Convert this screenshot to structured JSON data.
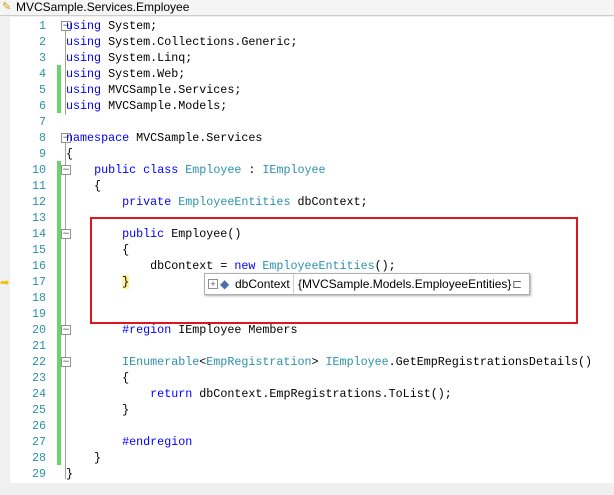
{
  "window": {
    "title": "MVCSample.Services.Employee"
  },
  "code": [
    {
      "n": "1",
      "t": [
        [
          "kw",
          "using"
        ],
        [
          "pl",
          " System;"
        ]
      ]
    },
    {
      "n": "2",
      "t": [
        [
          "kw",
          "using"
        ],
        [
          "pl",
          " System.Collections.Generic;"
        ]
      ]
    },
    {
      "n": "3",
      "t": [
        [
          "kw",
          "using"
        ],
        [
          "pl",
          " System.Linq;"
        ]
      ]
    },
    {
      "n": "4",
      "t": [
        [
          "kw",
          "using"
        ],
        [
          "pl",
          " System.Web;"
        ]
      ]
    },
    {
      "n": "5",
      "t": [
        [
          "kw",
          "using"
        ],
        [
          "pl",
          " MVCSample.Services;"
        ]
      ]
    },
    {
      "n": "6",
      "t": [
        [
          "kw",
          "using"
        ],
        [
          "pl",
          " MVCSample.Models;"
        ]
      ]
    },
    {
      "n": "7",
      "t": []
    },
    {
      "n": "8",
      "t": [
        [
          "kw",
          "namespace"
        ],
        [
          "pl",
          " MVCSample.Services"
        ]
      ]
    },
    {
      "n": "9",
      "t": [
        [
          "pl",
          "{"
        ]
      ]
    },
    {
      "n": "10",
      "t": [
        [
          "pl",
          "    "
        ],
        [
          "kw",
          "public"
        ],
        [
          "pl",
          " "
        ],
        [
          "kw",
          "class"
        ],
        [
          "pl",
          " "
        ],
        [
          "ty",
          "Employee"
        ],
        [
          "pl",
          " : "
        ],
        [
          "ty",
          "IEmployee"
        ]
      ]
    },
    {
      "n": "11",
      "t": [
        [
          "pl",
          "    {"
        ]
      ]
    },
    {
      "n": "12",
      "t": [
        [
          "pl",
          "        "
        ],
        [
          "kw",
          "private"
        ],
        [
          "pl",
          " "
        ],
        [
          "ty",
          "EmployeeEntities"
        ],
        [
          "pl",
          " dbContext;"
        ]
      ]
    },
    {
      "n": "13",
      "t": []
    },
    {
      "n": "14",
      "t": [
        [
          "pl",
          "        "
        ],
        [
          "kw",
          "public"
        ],
        [
          "pl",
          " Employee()"
        ]
      ]
    },
    {
      "n": "15",
      "t": [
        [
          "pl",
          "        {"
        ]
      ]
    },
    {
      "n": "16",
      "t": [
        [
          "pl",
          "            dbContext = "
        ],
        [
          "kw",
          "new"
        ],
        [
          "pl",
          " "
        ],
        [
          "ty",
          "EmployeeEntities"
        ],
        [
          "pl",
          "();"
        ]
      ]
    },
    {
      "n": "17",
      "t": [
        [
          "pl",
          "        "
        ],
        [
          "hl",
          "}"
        ]
      ]
    },
    {
      "n": "18",
      "t": []
    },
    {
      "n": "19",
      "t": []
    },
    {
      "n": "20",
      "t": [
        [
          "pl",
          "        "
        ],
        [
          "kw",
          "#region"
        ],
        [
          "pl",
          " IEmployee Members"
        ]
      ]
    },
    {
      "n": "21",
      "t": []
    },
    {
      "n": "22",
      "t": [
        [
          "pl",
          "        "
        ],
        [
          "ty",
          "IEnumerable"
        ],
        [
          "pl",
          "<"
        ],
        [
          "ty",
          "EmpRegistration"
        ],
        [
          "pl",
          "> "
        ],
        [
          "ty",
          "IEmployee"
        ],
        [
          "pl",
          ".GetEmpRegistrationsDetails()"
        ]
      ]
    },
    {
      "n": "23",
      "t": [
        [
          "pl",
          "        {"
        ]
      ]
    },
    {
      "n": "24",
      "t": [
        [
          "pl",
          "            "
        ],
        [
          "kw",
          "return"
        ],
        [
          "pl",
          " dbContext.EmpRegistrations.ToList();"
        ]
      ]
    },
    {
      "n": "25",
      "t": [
        [
          "pl",
          "        }"
        ]
      ]
    },
    {
      "n": "26",
      "t": []
    },
    {
      "n": "27",
      "t": [
        [
          "pl",
          "        "
        ],
        [
          "kw",
          "#endregion"
        ]
      ]
    },
    {
      "n": "28",
      "t": [
        [
          "pl",
          "    }"
        ]
      ]
    },
    {
      "n": "29",
      "t": [
        [
          "pl",
          "}"
        ]
      ]
    }
  ],
  "datatip": {
    "name": "dbContext",
    "value": "{MVCSample.Models.EmployeeEntities}"
  }
}
